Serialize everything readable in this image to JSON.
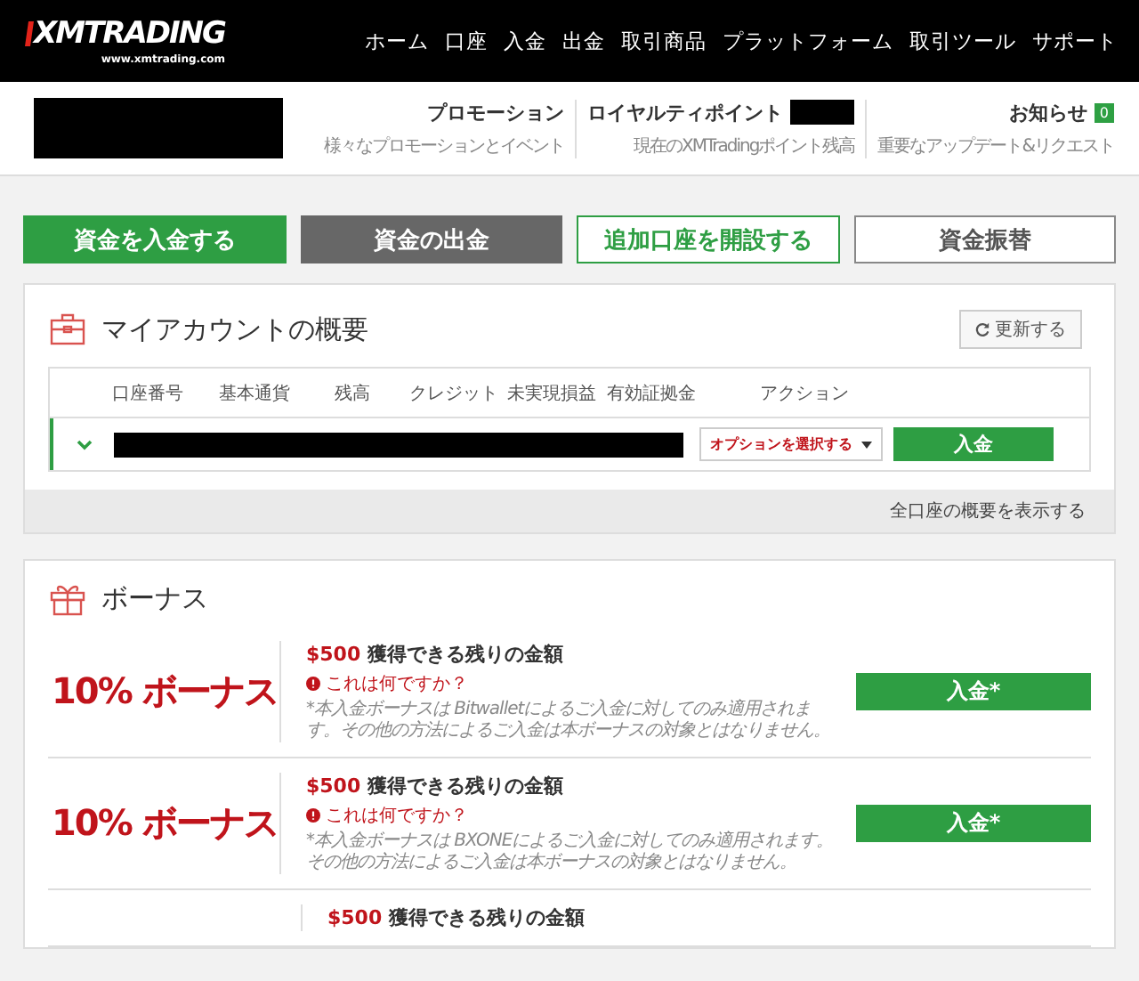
{
  "header": {
    "logo": "XMTRADING",
    "logo_url": "www.xmtrading.com",
    "nav": [
      "ホーム",
      "口座",
      "入金",
      "出金",
      "取引商品",
      "プラットフォーム",
      "取引ツール",
      "サポート"
    ]
  },
  "subheader": {
    "items": [
      {
        "kind": "plain",
        "title": "プロモーション",
        "subtitle": "様々なプロモーションとイベント"
      },
      {
        "kind": "redacted",
        "title": "ロイヤルティポイント",
        "subtitle": "現在のXMTradingポイント残高"
      },
      {
        "kind": "badge",
        "title": "お知らせ",
        "badge": "0",
        "subtitle": "重要なアップデート&リクエスト"
      }
    ]
  },
  "actions": [
    {
      "label": "資金を入金する",
      "kind": "primary"
    },
    {
      "label": "資金の出金",
      "kind": "dark"
    },
    {
      "label": "追加口座を開設する",
      "kind": "outline"
    },
    {
      "label": "資金振替",
      "kind": "plain"
    }
  ],
  "account": {
    "title": "マイアカウントの概要",
    "refresh": "更新する",
    "columns": [
      "口座番号",
      "基本通貨",
      "残高",
      "クレジット",
      "未実現損益",
      "有効証拠金",
      "アクション"
    ],
    "rows": [
      {
        "expanded": false,
        "option": "オプションを選択する",
        "deposit": "入金"
      }
    ],
    "footer_link": "全口座の概要を表示する"
  },
  "bonus": {
    "title": "ボーナス",
    "items": [
      {
        "headline": "10% ボーナス",
        "amount": "$500",
        "amount_label": "獲得できる残りの金額",
        "help": "これは何ですか？",
        "note": "*本入金ボーナスは Bitwalletによるご入金に対してのみ適用されます。その他の方法によるご入金は本ボーナスの対象とはなりません。",
        "button": "入金*"
      },
      {
        "headline": "10% ボーナス",
        "amount": "$500",
        "amount_label": "獲得できる残りの金額",
        "help": "これは何ですか？",
        "note": "*本入金ボーナスは BXONEによるご入金に対してのみ適用されます。その他の方法によるご入金は本ボーナスの対象とはなりません。",
        "button": "入金*"
      },
      {
        "amount": "$500",
        "amount_label": "獲得できる残りの金額"
      }
    ]
  }
}
